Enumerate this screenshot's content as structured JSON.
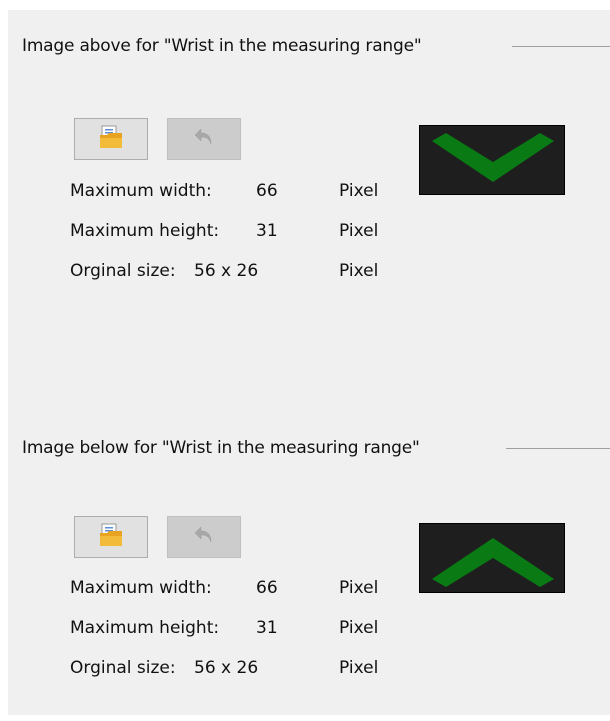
{
  "groups": [
    {
      "title": "Image above for \"Wrist in the measuring range\"",
      "open_icon": "folder-open-icon",
      "undo_icon": "undo-arrow-icon",
      "max_width_label": "Maximum width:",
      "max_width_value": "66",
      "max_height_label": "Maximum height:",
      "max_height_value": "31",
      "original_size_label": "Orginal size:",
      "original_size_value": "56 x 26",
      "unit": "Pixel",
      "preview_icon": "chevron-down-icon"
    },
    {
      "title": "Image below for \"Wrist in the measuring range\"",
      "open_icon": "folder-open-icon",
      "undo_icon": "undo-arrow-icon",
      "max_width_label": "Maximum width:",
      "max_width_value": "66",
      "max_height_label": "Maximum height:",
      "max_height_value": "31",
      "original_size_label": "Orginal size:",
      "original_size_value": "56 x 26",
      "unit": "Pixel",
      "preview_icon": "chevron-up-icon"
    }
  ],
  "colors": {
    "panel_bg": "#f0f0f0",
    "preview_bg": "#1e1e1e",
    "preview_arrow": "#0a7a14"
  }
}
